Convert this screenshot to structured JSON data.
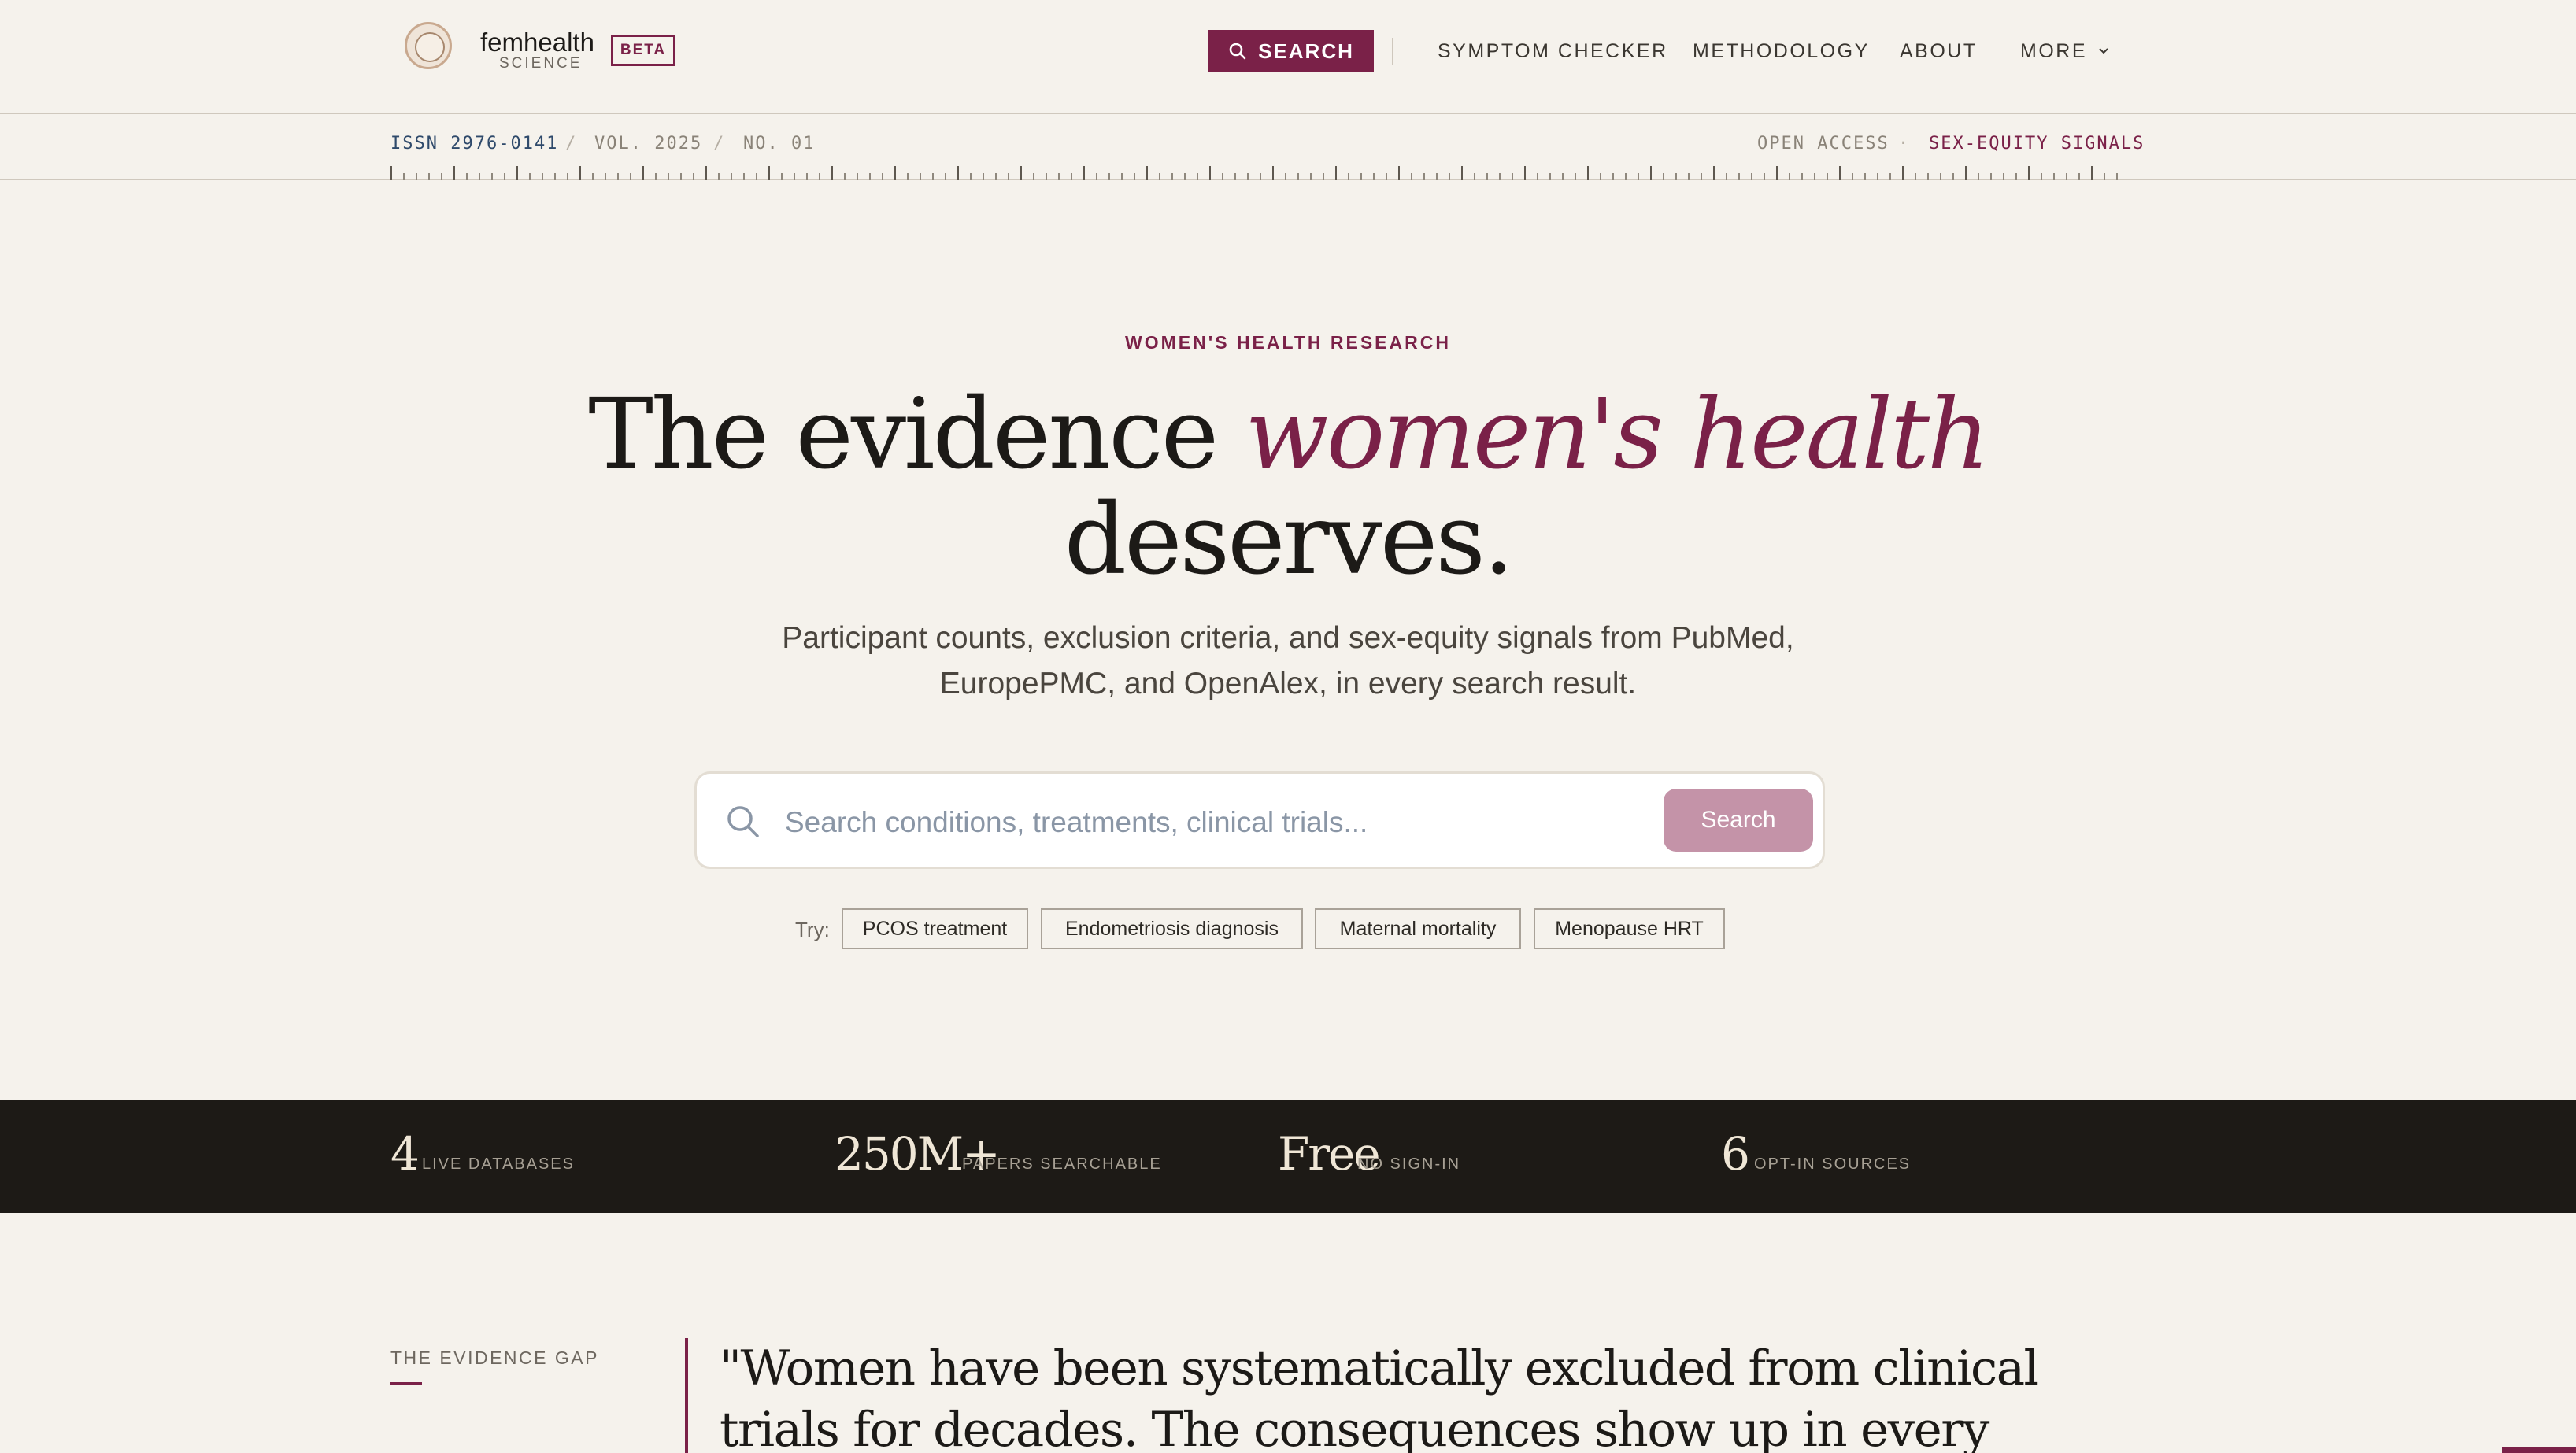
{
  "brand": {
    "name": "femhealth",
    "subtitle": "SCIENCE",
    "badge": "BETA"
  },
  "nav": {
    "search_label": "SEARCH",
    "links": [
      "SYMPTOM CHECKER",
      "METHODOLOGY",
      "ABOUT",
      "MORE"
    ]
  },
  "issn_bar": {
    "issn": "ISSN 2976-0141",
    "sep": "/",
    "vol": "VOL. 2025",
    "no": "NO. 01",
    "open_access": "OPEN ACCESS",
    "dot": "·",
    "signals": "SEX-EQUITY SIGNALS"
  },
  "hero": {
    "eyebrow": "WOMEN'S HEALTH RESEARCH",
    "title_part1": "The evidence ",
    "title_emphasis": "women's health",
    "title_part2": "deserves.",
    "subtitle": "Participant counts, exclusion criteria, and sex-equity signals from PubMed, EuropePMC, and OpenAlex, in every search result."
  },
  "search": {
    "placeholder": "Search conditions, treatments, clinical trials...",
    "button": "Search",
    "try_label": "Try:",
    "suggestions": [
      "PCOS treatment",
      "Endometriosis diagnosis",
      "Maternal mortality",
      "Menopause HRT"
    ]
  },
  "stats": [
    {
      "value": "4",
      "label": "LIVE DATABASES"
    },
    {
      "value": "250M+",
      "label": "PAPERS SEARCHABLE"
    },
    {
      "value": "Free",
      "label": "NO SIGN-IN"
    },
    {
      "value": "6",
      "label": "OPT-IN SOURCES"
    }
  ],
  "evidence_gap": {
    "label": "THE EVIDENCE GAP",
    "quote": "\"Women have been systematically excluded from clinical trials for decades. The consequences show up in every prescription, every diagnosis.\""
  },
  "colors": {
    "accent": "#7a2148",
    "background": "#f5f2ec",
    "dark_band": "#1d1a16",
    "issn_blue": "#2f4a6b"
  },
  "icons": {
    "search": "search-icon",
    "chevron": "chevron-down-icon",
    "seal": "seal-logo-icon"
  }
}
